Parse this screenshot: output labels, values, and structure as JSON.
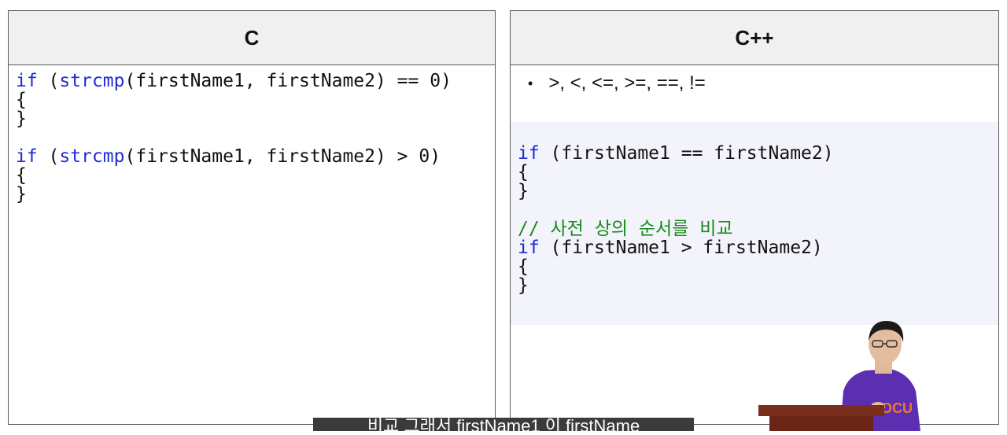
{
  "c_panel": {
    "title": "C",
    "code": [
      [
        {
          "t": "kw",
          "v": "if"
        },
        {
          "t": "p",
          "v": " ("
        },
        {
          "t": "kw",
          "v": "strcmp"
        },
        {
          "t": "p",
          "v": "(firstName1, firstName2) == 0)"
        }
      ],
      [
        {
          "t": "p",
          "v": "{"
        }
      ],
      [
        {
          "t": "p",
          "v": "}"
        }
      ],
      [],
      [
        {
          "t": "kw",
          "v": "if"
        },
        {
          "t": "p",
          "v": " ("
        },
        {
          "t": "kw",
          "v": "strcmp"
        },
        {
          "t": "p",
          "v": "(firstName1, firstName2) > 0)"
        }
      ],
      [
        {
          "t": "p",
          "v": "{"
        }
      ],
      [
        {
          "t": "p",
          "v": "}"
        }
      ]
    ]
  },
  "cpp_panel": {
    "title": "C++",
    "bullet": "•",
    "operators": ">, <, <=, >=, ==, !=",
    "code": [
      [
        {
          "t": "kw",
          "v": "if"
        },
        {
          "t": "p",
          "v": " (firstName1 == firstName2)"
        }
      ],
      [
        {
          "t": "p",
          "v": "{"
        }
      ],
      [
        {
          "t": "p",
          "v": "}"
        }
      ],
      [],
      [
        {
          "t": "cm",
          "v": "// 사전 상의 순서를 비교"
        }
      ],
      [
        {
          "t": "kw",
          "v": "if"
        },
        {
          "t": "p",
          "v": " (firstName1 > firstName2)"
        }
      ],
      [
        {
          "t": "p",
          "v": "{"
        }
      ],
      [
        {
          "t": "p",
          "v": "}"
        }
      ]
    ]
  },
  "presenter": {
    "shirt_text": "POCU",
    "shirt_color": "#5b2fb0",
    "podium_color": "#7a2e1e"
  },
  "caption": {
    "text": "비교 그래서 firstName1 이 firstName"
  }
}
